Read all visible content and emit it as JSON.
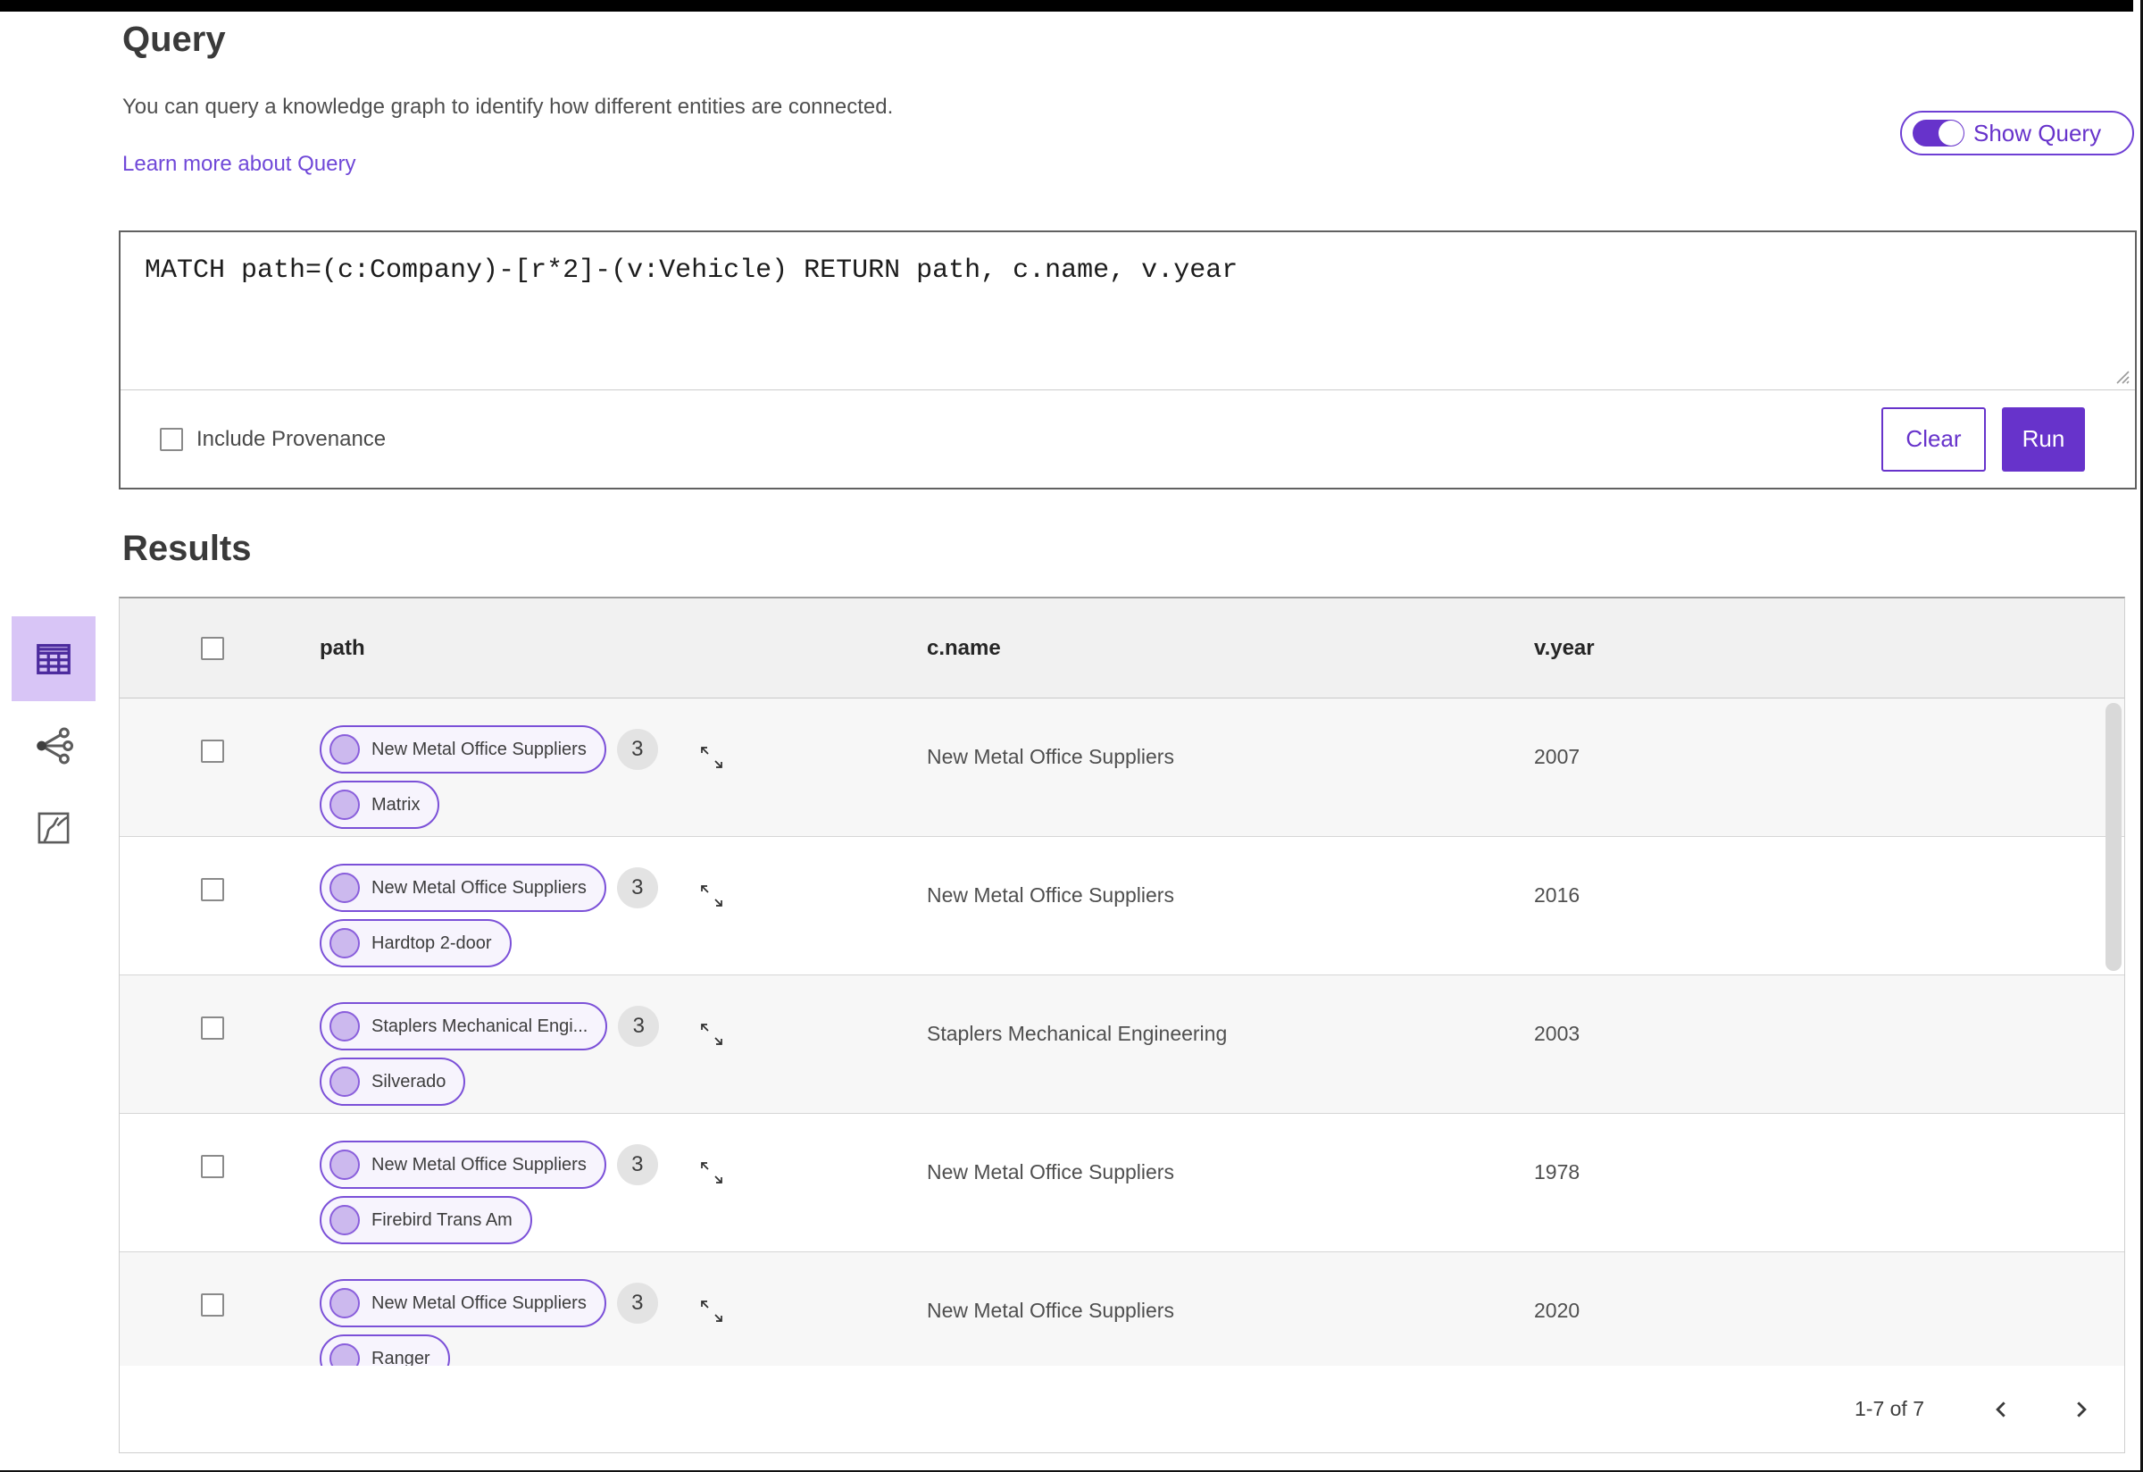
{
  "header": {
    "title": "Query",
    "description": "You can query a knowledge graph to identify how different entities are connected.",
    "learn_more_link": "Learn more about Query",
    "show_query_toggle": {
      "label": "Show Query",
      "state": "on"
    }
  },
  "query_editor": {
    "query_text": "MATCH path=(c:Company)-[r*2]-(v:Vehicle) RETURN path, c.name, v.year",
    "include_provenance": {
      "label": "Include Provenance",
      "checked": false
    },
    "buttons": {
      "clear": "Clear",
      "run": "Run"
    }
  },
  "results": {
    "title": "Results",
    "view_switcher": [
      {
        "name": "table-view",
        "selected": true
      },
      {
        "name": "graph-view",
        "selected": false
      },
      {
        "name": "chart-view",
        "selected": false
      }
    ],
    "table": {
      "columns": [
        "path",
        "c.name",
        "v.year"
      ],
      "rows": [
        {
          "path_nodes": [
            "New Metal Office Suppliers",
            "Matrix"
          ],
          "badge": "3",
          "c_name": "New Metal Office Suppliers",
          "v_year": "2007"
        },
        {
          "path_nodes": [
            "New Metal Office Suppliers",
            "Hardtop 2-door"
          ],
          "badge": "3",
          "c_name": "New Metal Office Suppliers",
          "v_year": "2016"
        },
        {
          "path_nodes": [
            "Staplers Mechanical Engi...",
            "Silverado"
          ],
          "badge": "3",
          "c_name": "Staplers Mechanical Engineering",
          "v_year": "2003"
        },
        {
          "path_nodes": [
            "New Metal Office Suppliers",
            "Firebird Trans Am"
          ],
          "badge": "3",
          "c_name": "New Metal Office Suppliers",
          "v_year": "1978"
        },
        {
          "path_nodes": [
            "New Metal Office Suppliers",
            "Ranger"
          ],
          "badge": "3",
          "c_name": "New Metal Office Suppliers",
          "v_year": "2020"
        }
      ],
      "pagination": {
        "range": "1-7 of 7"
      }
    }
  },
  "colors": {
    "accent_purple": "#6733cb",
    "selected_tile": "#d8c5f6",
    "pill_border": "#7b50d8",
    "pill_background": "#f7f4fd",
    "node_circle_fill": "#ccb9ee",
    "badge_background": "#e3e3e3",
    "link": "#7048d8",
    "table_header_background": "#f1f1f1",
    "row_stripe": "#f7f7f7"
  }
}
